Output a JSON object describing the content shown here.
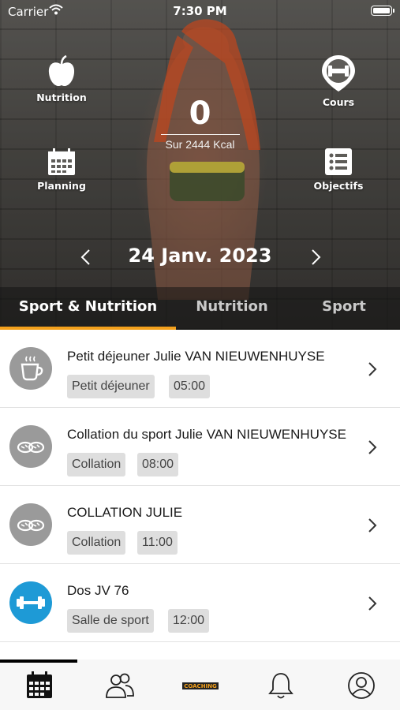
{
  "status_bar": {
    "carrier": "Carrier",
    "time": "7:30 PM"
  },
  "hero": {
    "nutrition_label": "Nutrition",
    "cours_label": "Cours",
    "planning_label": "Planning",
    "objectifs_label": "Objectifs",
    "kcal_value": "0",
    "kcal_subtitle": "Sur 2444 Kcal",
    "date": "24 Janv. 2023"
  },
  "tabs": [
    {
      "label": "Sport & Nutrition",
      "active": true
    },
    {
      "label": "Nutrition",
      "active": false
    },
    {
      "label": "Sport",
      "active": false
    }
  ],
  "accent_color": "#f3a01c",
  "items": [
    {
      "title": "Petit déjeuner Julie VAN NIEUWENHUYSE",
      "tag": "Petit déjeuner",
      "time": "05:00",
      "icon": "coffee-cup-icon",
      "icon_color": "#9a9a9a"
    },
    {
      "title": "Collation du sport Julie VAN NIEUWENHUYSE",
      "tag": "Collation",
      "time": "08:00",
      "icon": "cookies-icon",
      "icon_color": "#9a9a9a"
    },
    {
      "title": "COLLATION JULIE",
      "tag": "Collation",
      "time": "11:00",
      "icon": "cookies-icon",
      "icon_color": "#9a9a9a"
    },
    {
      "title": "Dos JV 76",
      "tag": "Salle de sport",
      "time": "12:00",
      "icon": "dumbbell-icon",
      "icon_color": "#1e9ad6"
    }
  ],
  "bottom_nav": {
    "items": [
      "calendar-icon",
      "users-icon",
      "coaching-logo",
      "bell-icon",
      "profile-icon"
    ],
    "logo_text": "COACHING"
  }
}
